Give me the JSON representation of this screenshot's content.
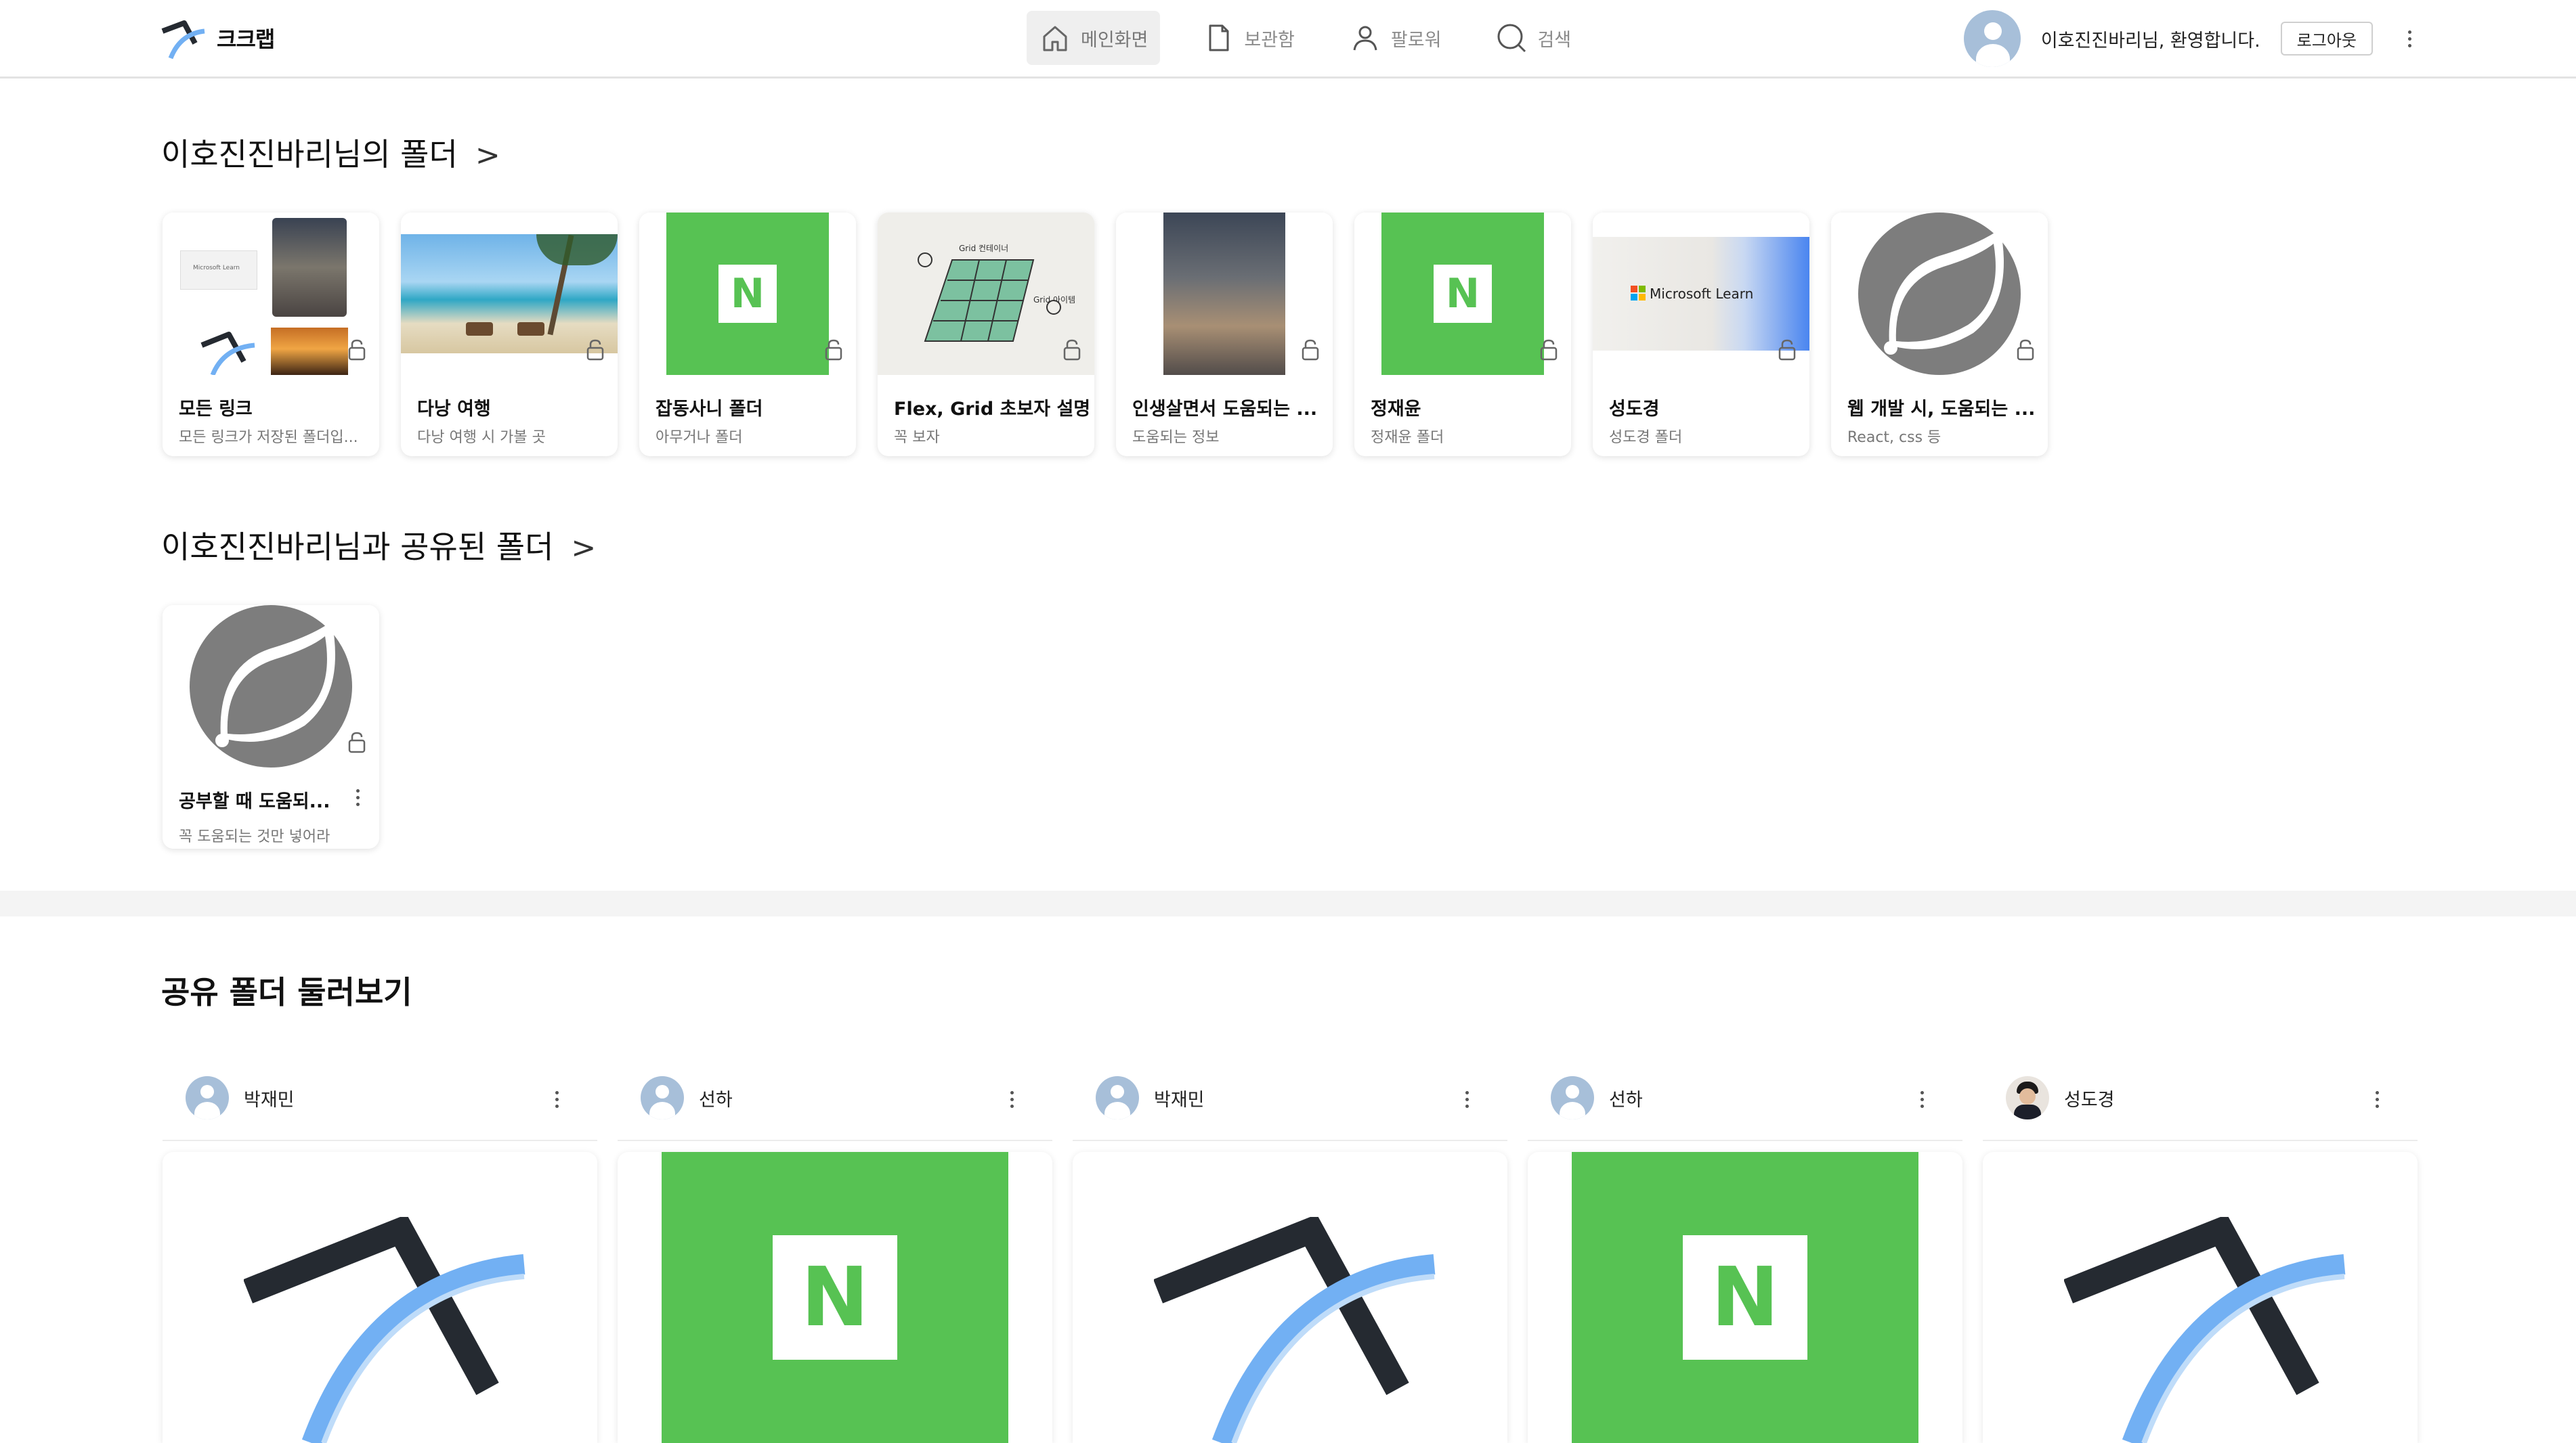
{
  "brand": {
    "name": "크크랩"
  },
  "nav": {
    "items": [
      {
        "label": "메인화면",
        "icon": "home-icon",
        "active": true
      },
      {
        "label": "보관함",
        "icon": "document-icon",
        "active": false
      },
      {
        "label": "팔로워",
        "icon": "person-icon",
        "active": false
      },
      {
        "label": "검색",
        "icon": "search-icon",
        "active": false
      }
    ]
  },
  "user": {
    "welcome": "이호진진바리님, 환영합니다.",
    "logout_label": "로그아웃"
  },
  "my_folders": {
    "title": "이호진진바리님의 폴더",
    "arrow": ">",
    "items": [
      {
        "name": "모든 링크",
        "desc": "모든 링크가 저장된 폴더입...",
        "thumb": "collage"
      },
      {
        "name": "다낭 여행",
        "desc": "다낭 여행 시 가볼 곳",
        "thumb": "beach"
      },
      {
        "name": "잡동사니 폴더",
        "desc": "아무거나 폴더",
        "thumb": "naver"
      },
      {
        "name": "Flex, Grid 초보자 설명",
        "desc": "꼭 보자",
        "thumb": "grid"
      },
      {
        "name": "인생살면서 도움되는 ...",
        "desc": "도움되는 정보",
        "thumb": "sky"
      },
      {
        "name": "정재윤",
        "desc": "정재윤 폴더",
        "thumb": "naver"
      },
      {
        "name": "성도경",
        "desc": "성도경 폴더",
        "thumb": "ms"
      },
      {
        "name": "웹 개발 시, 도움되는 ...",
        "desc": "React, css 등",
        "thumb": "spring"
      }
    ],
    "thumb_texts": {
      "ms_label": "Microsoft Learn",
      "ms_small": "Microsoft Learn",
      "grid_note_1": "Grid 컨테이너",
      "grid_note_2": "Grid 아이템"
    }
  },
  "shared_folders": {
    "title": "이호진진바리님과 공유된 폴더",
    "arrow": ">",
    "items": [
      {
        "name": "공부할 때 도움되...",
        "desc": "꼭 도움되는 것만 넣어라",
        "thumb": "spring"
      }
    ]
  },
  "browse": {
    "title": "공유 폴더 둘러보기",
    "items": [
      {
        "owner": "박재민",
        "avatar": "default",
        "thumb": "logo"
      },
      {
        "owner": "선하",
        "avatar": "default",
        "thumb": "naver"
      },
      {
        "owner": "박재민",
        "avatar": "default",
        "thumb": "logo"
      },
      {
        "owner": "선하",
        "avatar": "default",
        "thumb": "naver"
      },
      {
        "owner": "성도경",
        "avatar": "photo",
        "thumb": "logo"
      }
    ]
  },
  "naver_letter": "N",
  "colors": {
    "naver_green": "#57c253",
    "logo_dark": "#252a31",
    "logo_blue": "#72b0f3",
    "spring_gray": "#7d7d7d"
  }
}
